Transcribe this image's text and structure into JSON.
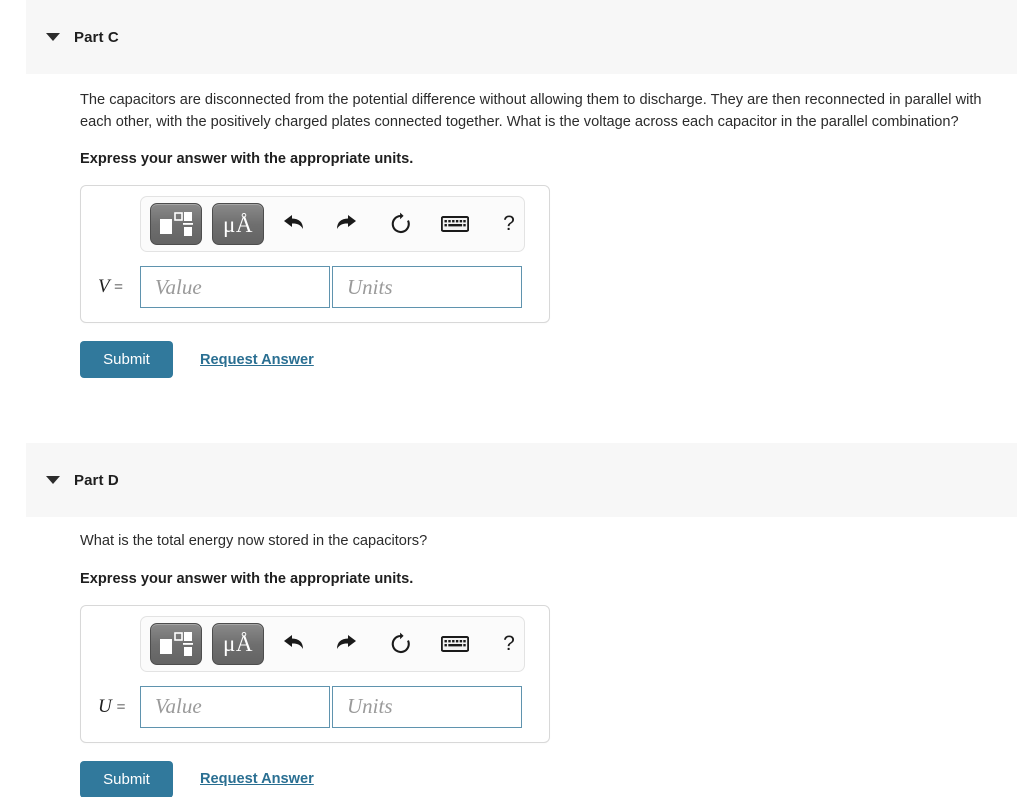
{
  "colors": {
    "submit_bg": "#31799c",
    "link": "#2a6f92",
    "header_band": "#f7f7f7",
    "input_border": "#5f93ae",
    "toolbar_button": "#6f6f6f"
  },
  "toolbar": {
    "buttons": [
      {
        "name": "template-icon",
        "label": "",
        "kind": "template"
      },
      {
        "name": "units-icon",
        "label": "μÅ",
        "kind": "units"
      },
      {
        "name": "undo-icon",
        "label": "",
        "kind": "undo"
      },
      {
        "name": "redo-icon",
        "label": "",
        "kind": "redo"
      },
      {
        "name": "reset-icon",
        "label": "",
        "kind": "reset"
      },
      {
        "name": "keyboard-icon",
        "label": "",
        "kind": "keyboard"
      },
      {
        "name": "help-icon",
        "label": "?",
        "kind": "help"
      }
    ]
  },
  "parts": [
    {
      "id": "part-c",
      "title": "Part C",
      "prompt": "The capacitors are disconnected from the potential difference without allowing them to discharge. They are then reconnected in parallel with each other, with the positively charged plates connected together. What is the voltage across each capacitor in the parallel combination?",
      "express": "Express your answer with the appropriate units.",
      "variable": "V",
      "equals": "=",
      "value_placeholder": "Value",
      "value_current": "",
      "units_placeholder": "Units",
      "units_current": "",
      "submit_label": "Submit",
      "request_label": "Request Answer"
    },
    {
      "id": "part-d",
      "title": "Part D",
      "prompt": "What is the total energy now stored in the capacitors?",
      "express": "Express your answer with the appropriate units.",
      "variable": "U",
      "equals": "=",
      "value_placeholder": "Value",
      "value_current": "",
      "units_placeholder": "Units",
      "units_current": "",
      "submit_label": "Submit",
      "request_label": "Request Answer"
    }
  ]
}
